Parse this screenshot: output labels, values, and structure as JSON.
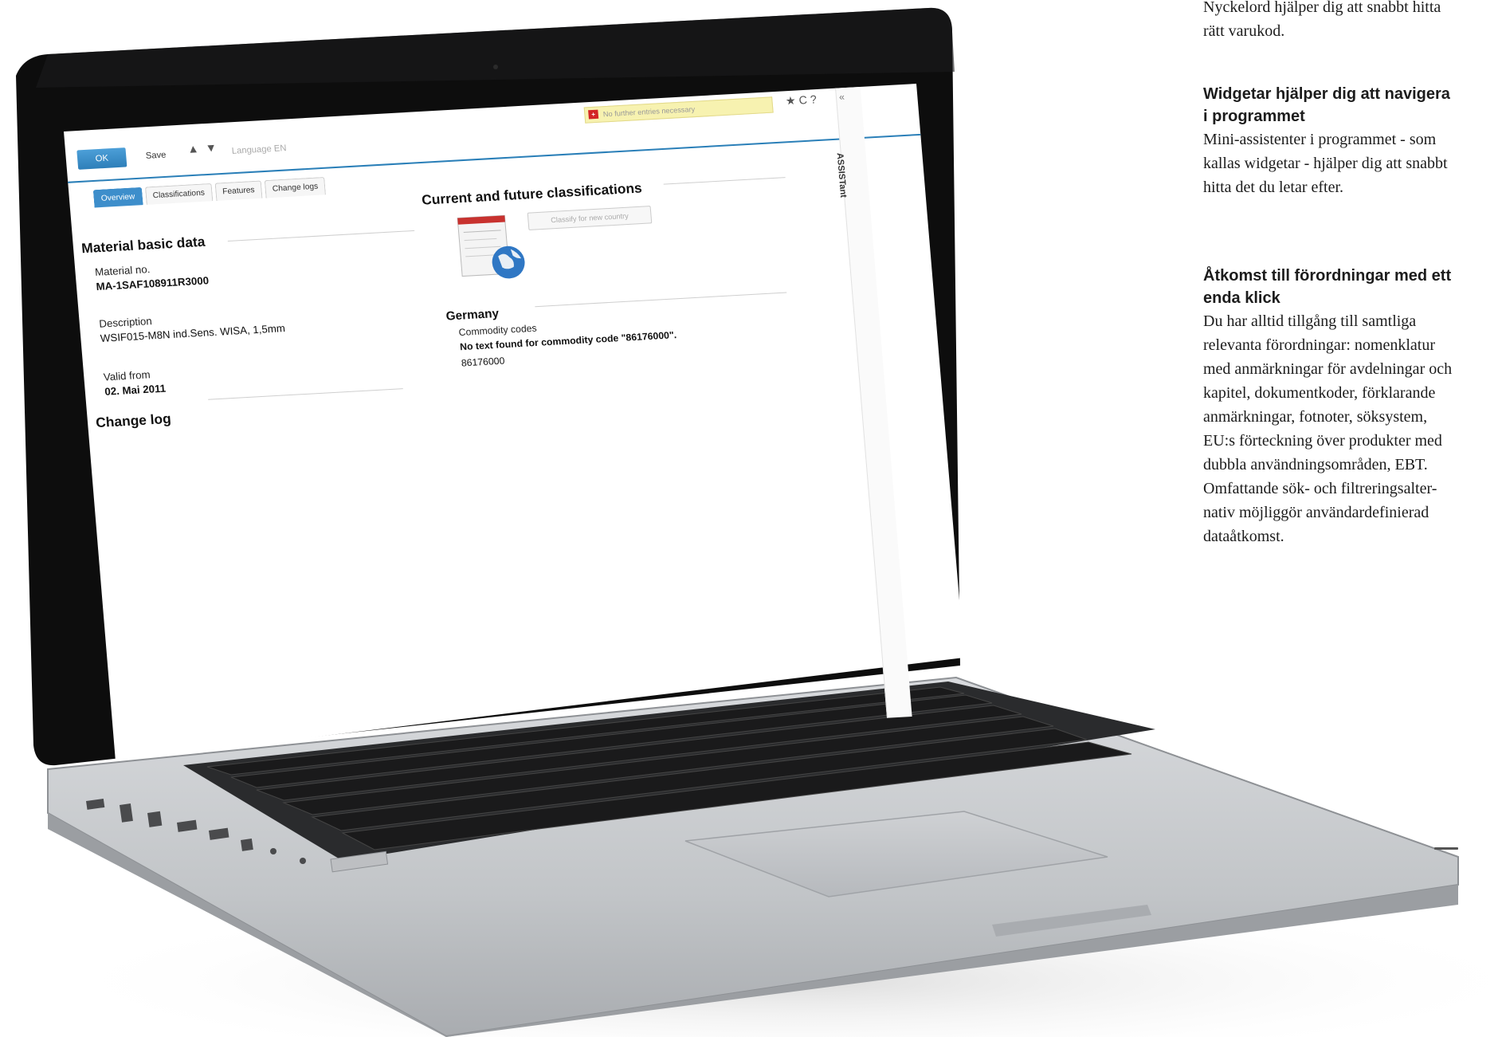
{
  "app": {
    "ok_label": "OK",
    "save_label": "Save",
    "language_label": "Language EN",
    "notice_text": "No further entries necessary",
    "assistant_label": "ASSISTant",
    "collapse_glyph": "«",
    "toolbar_glyphs": "★ C ?",
    "tabs": [
      {
        "label": "Overview",
        "active": true
      },
      {
        "label": "Classifications",
        "active": false
      },
      {
        "label": "Features",
        "active": false
      },
      {
        "label": "Change logs",
        "active": false
      }
    ],
    "material": {
      "section_title": "Material basic data",
      "material_no_label": "Material no.",
      "material_no_value": "MA-1SAF108911R3000",
      "description_label": "Description",
      "description_value": "WSIF015-M8N ind.Sens. WISA, 1,5mm",
      "valid_from_label": "Valid from",
      "valid_from_value": "02. Mai 2011"
    },
    "change_log_title": "Change log",
    "classifications": {
      "section_title": "Current and future classifications",
      "classify_button": "Classify for new country",
      "country": "Germany",
      "commodity_label": "Commodity codes",
      "commodity_message": "No text found for commodity code \"86176000\".",
      "commodity_code": "86176000"
    }
  },
  "article": {
    "intro_lines": [
      "Nyckelord hjälper dig att snabbt hitta",
      "rätt varukod."
    ],
    "sections": [
      {
        "heading_lines": [
          "Widgetar hjälper dig att navigera",
          "i programmet"
        ],
        "body_lines": [
          "Mini-assistenter i programmet - som",
          "kallas widgetar - hjälper dig att snabbt",
          "hitta det du letar efter."
        ]
      },
      {
        "heading_lines": [
          "Åtkomst till förordningar med ett",
          "enda klick"
        ],
        "body_lines": [
          "Du har alltid tillgång till samtliga",
          "relevanta förordningar: nomenklatur",
          "med anmärkningar för avdelningar och",
          "kapitel, dokumentkoder, förklarande",
          "anmärkningar, fotnoter, söksystem,",
          "EU:s förteckning över produkter med",
          "dubbla användningsområden, EBT.",
          "Omfattande sök- och filtreringsalter-",
          "nativ möjliggör användardefinierad",
          "dataåtkomst."
        ]
      }
    ]
  },
  "colors": {
    "accent": "#2e7fb9",
    "notice_bg": "#f7f2b0",
    "notice_flag": "#d32525",
    "laptop_body": "#c9cbce",
    "bezel": "#0d0d0d"
  }
}
